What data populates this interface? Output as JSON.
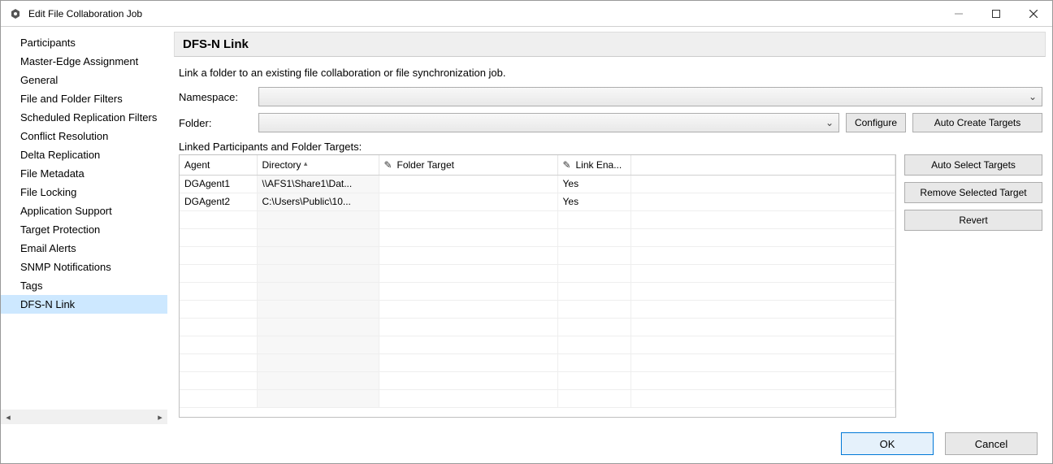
{
  "window": {
    "title": "Edit File Collaboration Job"
  },
  "sidebar": {
    "items": [
      {
        "label": "Participants"
      },
      {
        "label": "Master-Edge Assignment"
      },
      {
        "label": "General"
      },
      {
        "label": "File and Folder Filters"
      },
      {
        "label": "Scheduled Replication Filters"
      },
      {
        "label": "Conflict Resolution"
      },
      {
        "label": "Delta Replication"
      },
      {
        "label": "File Metadata"
      },
      {
        "label": "File Locking"
      },
      {
        "label": "Application Support"
      },
      {
        "label": "Target Protection"
      },
      {
        "label": "Email Alerts"
      },
      {
        "label": "SNMP Notifications"
      },
      {
        "label": "Tags"
      },
      {
        "label": "DFS-N Link"
      }
    ],
    "selected_index": 14
  },
  "page": {
    "heading": "DFS-N Link",
    "instruction": "Link a folder to an existing file collaboration or file synchronization job.",
    "namespace_label": "Namespace:",
    "folder_label": "Folder:",
    "configure_label": "Configure",
    "auto_create_targets_label": "Auto Create Targets",
    "linked_label": "Linked Participants and Folder Targets:"
  },
  "table": {
    "columns": [
      {
        "label": "Agent"
      },
      {
        "label": "Directory",
        "sorted": "asc"
      },
      {
        "label": "Folder Target",
        "editable": true
      },
      {
        "label": "Link Ena...",
        "editable": true
      },
      {
        "label": ""
      }
    ],
    "rows": [
      {
        "agent": "DGAgent1",
        "directory": "\\\\AFS1\\Share1\\Dat...",
        "folder_target": "",
        "link_enabled": "Yes"
      },
      {
        "agent": "DGAgent2",
        "directory": "C:\\Users\\Public\\10...",
        "folder_target": "",
        "link_enabled": "Yes"
      }
    ]
  },
  "side_buttons": {
    "auto_select": "Auto Select Targets",
    "remove_selected": "Remove Selected Target",
    "revert": "Revert"
  },
  "footer": {
    "ok": "OK",
    "cancel": "Cancel"
  }
}
